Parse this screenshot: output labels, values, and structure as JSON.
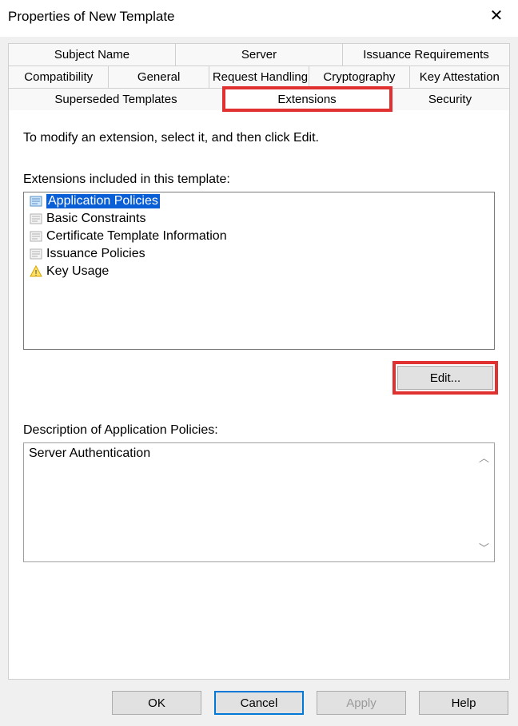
{
  "title": "Properties of New Template",
  "tabs": {
    "row1": [
      {
        "label": "Subject Name"
      },
      {
        "label": "Server"
      },
      {
        "label": "Issuance Requirements"
      }
    ],
    "row2": [
      {
        "label": "Compatibility"
      },
      {
        "label": "General"
      },
      {
        "label": "Request Handling"
      },
      {
        "label": "Cryptography"
      },
      {
        "label": "Key Attestation"
      }
    ],
    "row3": [
      {
        "label": "Superseded Templates"
      },
      {
        "label": "Extensions"
      },
      {
        "label": "Security"
      }
    ]
  },
  "panel": {
    "instruction": "To modify an extension, select it, and then click Edit.",
    "list_label": "Extensions included in this template:",
    "items": [
      {
        "label": "Application Policies",
        "selected": true,
        "icon": "cert"
      },
      {
        "label": "Basic Constraints",
        "selected": false,
        "icon": "cert"
      },
      {
        "label": "Certificate Template Information",
        "selected": false,
        "icon": "cert"
      },
      {
        "label": "Issuance Policies",
        "selected": false,
        "icon": "cert"
      },
      {
        "label": "Key Usage",
        "selected": false,
        "icon": "warn"
      }
    ],
    "edit_label": "Edit...",
    "desc_label": "Description of Application Policies:",
    "desc_text": "Server Authentication"
  },
  "buttons": {
    "ok": "OK",
    "cancel": "Cancel",
    "apply": "Apply",
    "help": "Help"
  }
}
